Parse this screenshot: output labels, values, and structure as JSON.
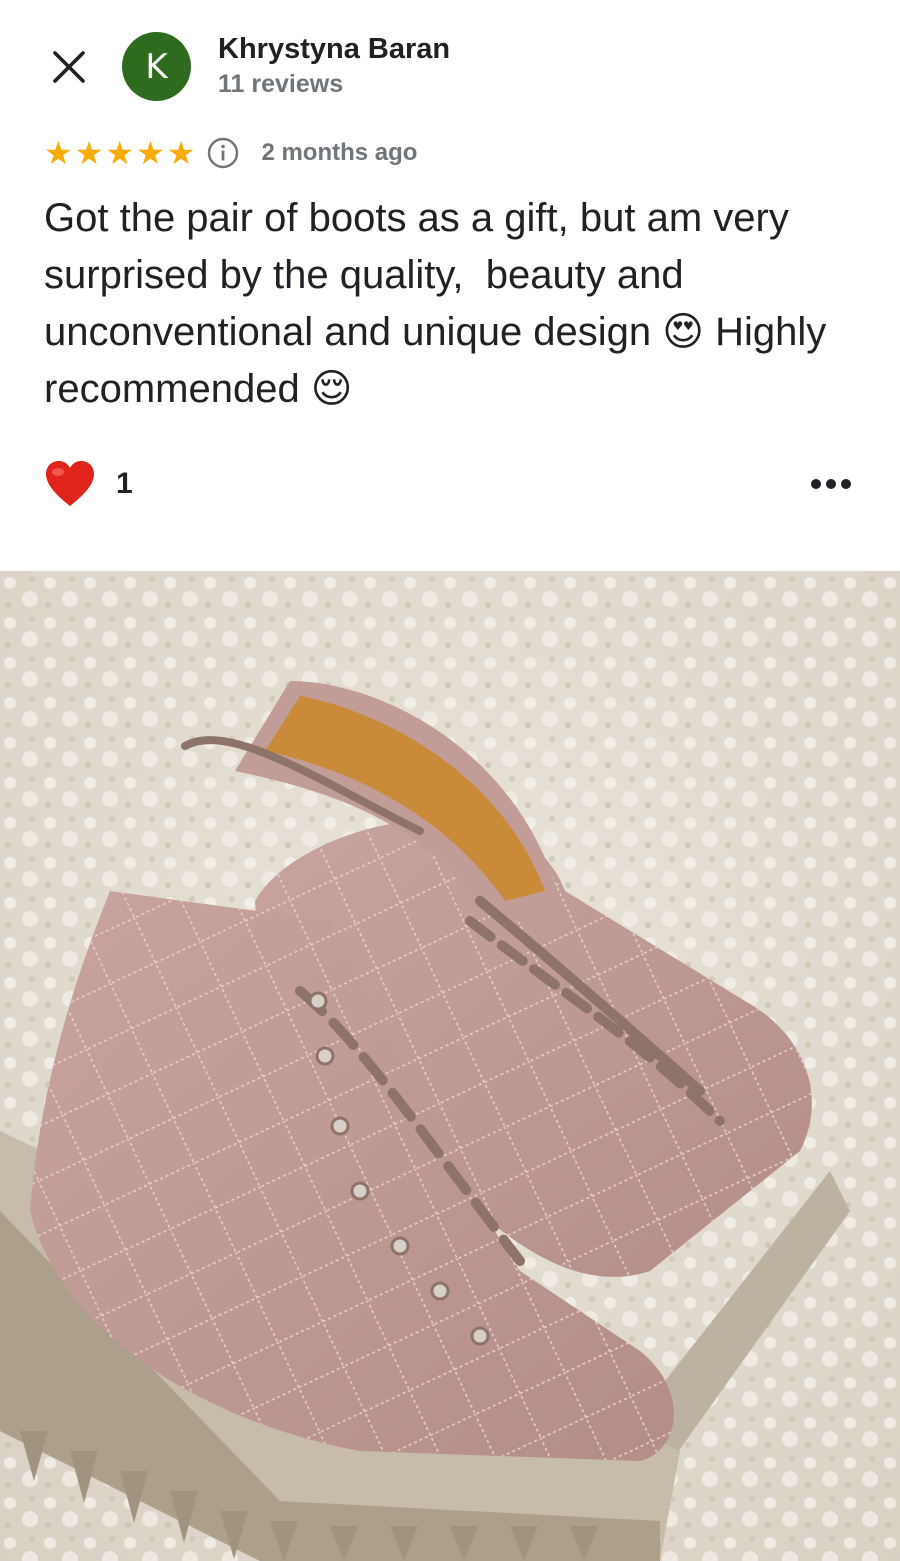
{
  "reviewer": {
    "avatar_letter": "K",
    "name": "Khrystyna Baran",
    "review_count": "11 reviews"
  },
  "review": {
    "rating": 5,
    "max_rating": 5,
    "stars": "★★★★★",
    "time_ago": "2 months ago",
    "text_part1": "Got the pair of boots as a gift, but am very surprised by the quality,  beauty and unconventional and unique design ",
    "emoji_heart_eyes": "😍",
    "text_part2": " Highly recommended ",
    "emoji_relieved": "😌"
  },
  "reactions": {
    "like_count": "1"
  },
  "colors": {
    "avatar_bg": "#2e6b1f",
    "star": "#f9ab00",
    "heart": "#e0241b",
    "secondary_text": "#70757a"
  },
  "icons": {
    "close": "close-icon",
    "info": "info-icon",
    "heart": "heart-icon",
    "more": "more-horizontal-icon"
  }
}
